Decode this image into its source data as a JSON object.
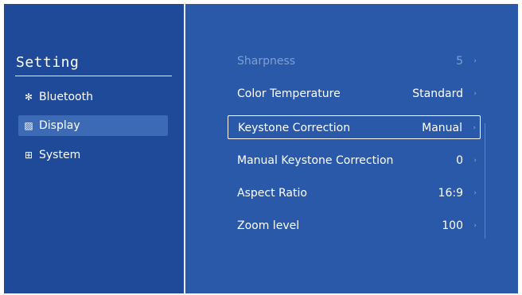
{
  "sidebar": {
    "title": "Setting",
    "items": [
      {
        "icon": "bluetooth-icon",
        "glyph": "✻",
        "label": "Bluetooth"
      },
      {
        "icon": "display-icon",
        "glyph": "▨",
        "label": "Display"
      },
      {
        "icon": "system-icon",
        "glyph": "⊞",
        "label": "System"
      }
    ]
  },
  "settings": [
    {
      "label": "Sharpness",
      "value": "5"
    },
    {
      "label": "Color Temperature",
      "value": "Standard"
    },
    {
      "label": "Keystone Correction",
      "value": "Manual"
    },
    {
      "label": "Manual Keystone Correction",
      "value": "0"
    },
    {
      "label": "Aspect Ratio",
      "value": "16:9"
    },
    {
      "label": "Zoom level",
      "value": "100"
    }
  ],
  "arrow_glyph": "›",
  "colors": {
    "background": "#2b59a9",
    "sidebar": "#1f4a99",
    "active_item": "#3d6ab5",
    "text": "#ffffff",
    "dim_text": "#7f9fd3"
  }
}
